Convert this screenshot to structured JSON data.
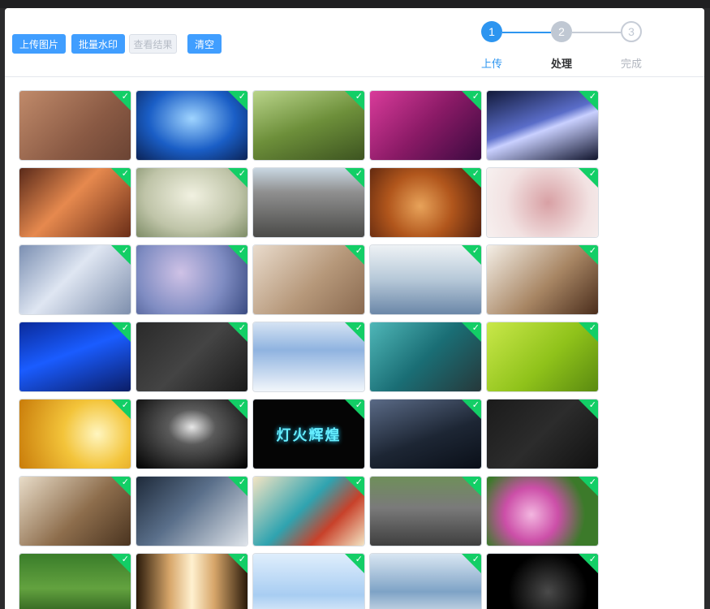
{
  "toolbar": {
    "upload_label": "上传图片",
    "watermark_label": "批量水印",
    "view_result_label": "查看结果",
    "clear_label": "清空"
  },
  "steps": [
    {
      "number": "1",
      "label": "上传",
      "status": "active"
    },
    {
      "number": "2",
      "label": "处理",
      "status": "current"
    },
    {
      "number": "3",
      "label": "完成",
      "status": "pending"
    }
  ],
  "colors": {
    "primary": "#409eff",
    "step_active": "#2d95f0",
    "success_badge": "#13ce66"
  },
  "gallery": {
    "check_glyph": "✓",
    "images": [
      {
        "name": "stars-wood",
        "bg": "linear-gradient(135deg,#c08a6a,#8a5a44 60%,#6b4434)"
      },
      {
        "name": "blue-tree",
        "bg": "radial-gradient(ellipse at 50% 40%,#9fd4ff,#1a5ec6 55%,#0b2357)"
      },
      {
        "name": "pink-flowers",
        "bg": "linear-gradient(160deg,#b9d48a,#6d8f3a 50%,#3d5420)"
      },
      {
        "name": "magenta-abstract",
        "bg": "linear-gradient(135deg,#d93b9a,#8a1a66 50%,#3b0a40)"
      },
      {
        "name": "light-streaks",
        "bg": "linear-gradient(160deg,#121a3a,#5a6dc9 45%,#c9d0ff 55%,#10142c)"
      },
      {
        "name": "seashell",
        "bg": "linear-gradient(135deg,#5a2a1a,#e6894e 45%,#6b2e18)"
      },
      {
        "name": "misty-castle",
        "bg": "radial-gradient(ellipse at 50% 40%,#f1f1e1,#bfc4a8 60%,#7d8c66)"
      },
      {
        "name": "pebbles",
        "bg": "linear-gradient(180deg,#c9d7e2,#8f8f8f 35%,#4a4a48)"
      },
      {
        "name": "pocket-watch",
        "bg": "radial-gradient(circle at 45% 55%,#e8a35a,#b1561c 45%,#4b1c0c)"
      },
      {
        "name": "dry-rose",
        "bg": "radial-gradient(circle at 55% 50%,#d8a0a4,#f2e2e2 60%,#f7f1f0)"
      },
      {
        "name": "silver-cubes",
        "bg": "linear-gradient(135deg,#7b8fb2,#dfe6f2 45%,#7e8fad)"
      },
      {
        "name": "blossom-branch",
        "bg": "radial-gradient(circle at 40% 40%,#cfc2e6,#7f8cc2 55%,#3a4b82)"
      },
      {
        "name": "headphones",
        "bg": "linear-gradient(135deg,#e9dbcc,#b6987a 55%,#8a6a50)"
      },
      {
        "name": "winter-mist",
        "bg": "linear-gradient(180deg,#eef2f5,#b6c8d8 50%,#6b87a8)"
      },
      {
        "name": "dining-room",
        "bg": "linear-gradient(135deg,#f4efe7,#a88664 55%,#4a2d1c)"
      },
      {
        "name": "blue-waves",
        "bg": "linear-gradient(160deg,#0a2a9a,#1a5cff 45%,#0b1d66)"
      },
      {
        "name": "dark-brick-logo",
        "bg": "linear-gradient(135deg,#2a2a2a,#444 50%,#1a1a1a)"
      },
      {
        "name": "screenshot-doc",
        "bg": "linear-gradient(180deg,#d5e3f3,#8fb3e0 40%,#f2f6fb)"
      },
      {
        "name": "cat-faucet",
        "bg": "linear-gradient(135deg,#4fb7b8,#1a6e75 50%,#26383a)"
      },
      {
        "name": "cats-green",
        "bg": "linear-gradient(135deg,#c9e84a,#8fc21a 55%,#5a8a10)"
      },
      {
        "name": "golden-rays",
        "bg": "radial-gradient(circle at 70% 50%,#fff6c0,#f3c43a 40%,#c97c0a)"
      },
      {
        "name": "white-smoke",
        "bg": "radial-gradient(ellipse at 50% 40%,#e8e8e8,#5a5a5a 30%,#000)"
      },
      {
        "name": "neon-text",
        "bg": "#050505",
        "text": "灯火辉煌"
      },
      {
        "name": "moon-woman",
        "bg": "linear-gradient(160deg,#5a6a86,#1d2634 55%,#0a0f18)"
      },
      {
        "name": "carbon-fiber",
        "bg": "linear-gradient(135deg,#1b1b1b,#2c2c2c 50%,#111)"
      },
      {
        "name": "bedroom",
        "bg": "linear-gradient(135deg,#e8dcc8,#8d6d4c 55%,#4a3420)"
      },
      {
        "name": "photoshop-ui",
        "bg": "linear-gradient(135deg,#1e2a3a,#5a6f8a 45%,#dfe4ea)"
      },
      {
        "name": "paint-hair",
        "bg": "linear-gradient(135deg,#f3e4c3,#2fa3b0 45%,#c8412a 70%,#f3e4c3)"
      },
      {
        "name": "white-car",
        "bg": "linear-gradient(180deg,#6f8f5a,#7a7a7a 45%,#3f3f3f)"
      },
      {
        "name": "peonies",
        "bg": "radial-gradient(circle at 40% 55%,#f3b6e0,#cc4fa8 35%,#3c7a2a 70%)"
      },
      {
        "name": "forest-girl",
        "bg": "linear-gradient(180deg,#3a7d2a,#63a23f 50%,#1f4b15)"
      },
      {
        "name": "curtain-light",
        "bg": "linear-gradient(90deg,#2a1a0a,#d7a66a 30%,#fff1d0 50%,#d7a66a 70%,#2a1a0a)"
      },
      {
        "name": "blue-sky-flowers",
        "bg": "linear-gradient(180deg,#dfeefc,#a8cdf2 60%,#f4f8fc)"
      },
      {
        "name": "blue-bedroom",
        "bg": "linear-gradient(180deg,#d9e6f2,#7ea3c6 55%,#e9eef3)"
      },
      {
        "name": "motorcycle-dark",
        "bg": "radial-gradient(circle at 55% 55%,#4a4a4a,#000 55%)"
      }
    ]
  }
}
